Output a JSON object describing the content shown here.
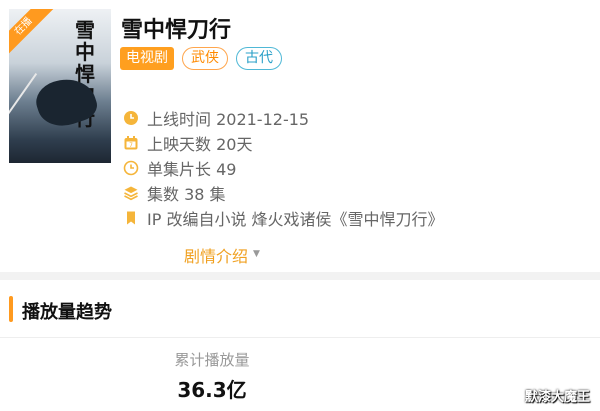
{
  "poster": {
    "ribbon": "在播",
    "title_art": "雪中悍刀行"
  },
  "title": "雪中悍刀行",
  "tags": {
    "main": "电视剧",
    "genre1": "武侠",
    "genre2": "古代"
  },
  "info": {
    "release": "上线时间 2021-12-15",
    "days": "上映天数 20天",
    "episode_length": "单集片长 49",
    "episodes": "集数 38 集",
    "ip": "IP 改编自小说 烽火戏诸侯《雪中悍刀行》"
  },
  "synopsis": {
    "label": "剧情介绍",
    "caret": "▼"
  },
  "section": {
    "title": "播放量趋势"
  },
  "stats": {
    "label": "累计播放量",
    "value": "36.3亿"
  },
  "watermark": "默漆大魔王",
  "colors": {
    "accent": "#ff9a1f",
    "info_icon": "#f5b53a",
    "tag_blue": "#2aa0c8"
  }
}
